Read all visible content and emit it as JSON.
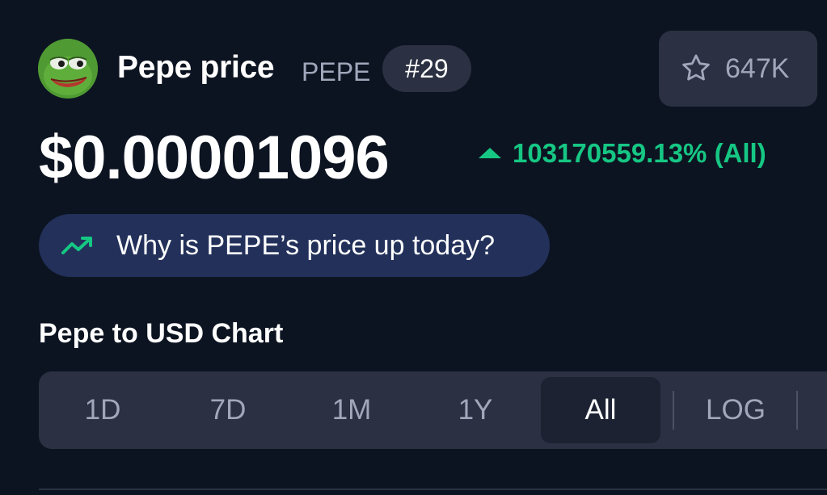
{
  "header": {
    "title": "Pepe price",
    "symbol": "PEPE",
    "rank": "#29",
    "watchlist_count": "647K",
    "logo_icon": "pepe-frog-logo-icon",
    "star_icon": "star-outline-icon"
  },
  "price": {
    "value": "$0.00001096",
    "change": "103170559.13% (All)",
    "change_direction": "up",
    "change_color": "#16c784"
  },
  "why": {
    "label": "Why is PEPE’s price up today?",
    "icon": "trending-up-icon",
    "icon_color": "#16c784"
  },
  "chart_section": {
    "title": "Pepe to USD Chart"
  },
  "range_tabs": {
    "items": [
      {
        "label": "1D"
      },
      {
        "label": "7D"
      },
      {
        "label": "1M"
      },
      {
        "label": "1Y"
      },
      {
        "label": "All"
      },
      {
        "label": "LOG"
      }
    ],
    "selected": "All"
  },
  "colors": {
    "background": "#0d1421",
    "panel": "#2b3142",
    "positive": "#16c784",
    "muted_text": "#a1a7bb",
    "why_pill": "#22305a"
  }
}
